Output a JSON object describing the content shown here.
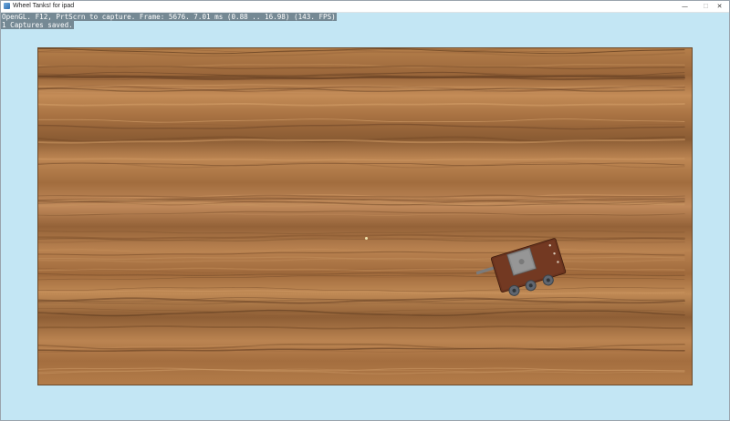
{
  "window": {
    "title": "Wheel Tanks! for ipad",
    "minimize_glyph": "—",
    "maximize_glyph": "☐",
    "close_glyph": "✕",
    "icon": "app-icon"
  },
  "hud": {
    "status_line": "OpenGL. F12, PrtScrn to capture. Frame: 5676. 7.01 ms (0.88 .. 16.98) (143. FPS)",
    "capture_line": "1 Captures saved."
  },
  "scene": {
    "background_color": "#c3e6f4",
    "board_texture": "wood-grain",
    "board_colors": [
      "#b07a47",
      "#a06a3b",
      "#7e5530",
      "#c68e58",
      "#8e5f35"
    ],
    "tank": {
      "hull_color": "#6a331e",
      "turret_color": "#8c8c8c",
      "wheel_color": "#5f6670",
      "barrel_color": "#7b7b7b"
    }
  }
}
